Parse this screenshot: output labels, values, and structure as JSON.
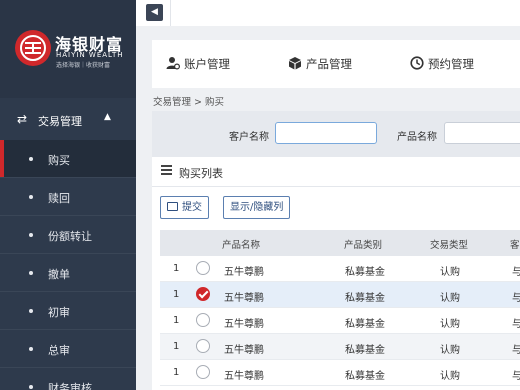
{
  "colors": {
    "sidebar_bg": "#2e3a4c",
    "brand_red": "#d0282b",
    "accent_blue": "#2f4f7f"
  },
  "logo": {
    "cn": "海银财富",
    "en": "HAIYIN WEALTH",
    "slogan": "选择海银｜收获财富"
  },
  "sidebar": {
    "group": {
      "icon": "swap-icon",
      "label": "交易管理",
      "expanded": true
    },
    "items": [
      {
        "label": "购买",
        "active": true
      },
      {
        "label": "赎回",
        "active": false
      },
      {
        "label": "份额转让",
        "active": false
      },
      {
        "label": "撤单",
        "active": false
      },
      {
        "label": "初审",
        "active": false
      },
      {
        "label": "总审",
        "active": false
      },
      {
        "label": "财务审核",
        "active": false
      }
    ]
  },
  "main_tabs": [
    {
      "icon": "user-gear-icon",
      "label": "账户管理"
    },
    {
      "icon": "cube-icon",
      "label": "产品管理"
    },
    {
      "icon": "clock-icon",
      "label": "预约管理"
    }
  ],
  "breadcrumb": "交易管理 > 购买",
  "search": {
    "customer_label": "客户名称",
    "customer_value": "",
    "product_label": "产品名称",
    "product_value": ""
  },
  "list": {
    "title": "购买列表",
    "submit_label": "提交",
    "toggle_columns_label": "显示/隐藏列",
    "columns": [
      "",
      "",
      "产品名称",
      "产品类别",
      "交易类型",
      "客"
    ],
    "rows": [
      {
        "no": "1",
        "selected": false,
        "product": "五牛尊鹏",
        "category": "私募基金",
        "type": "认购",
        "extra": "与"
      },
      {
        "no": "1",
        "selected": true,
        "product": "五牛尊鹏",
        "category": "私募基金",
        "type": "认购",
        "extra": "与"
      },
      {
        "no": "1",
        "selected": false,
        "product": "五牛尊鹏",
        "category": "私募基金",
        "type": "认购",
        "extra": "与"
      },
      {
        "no": "1",
        "selected": false,
        "product": "五牛尊鹏",
        "category": "私募基金",
        "type": "认购",
        "extra": "与"
      },
      {
        "no": "1",
        "selected": false,
        "product": "五牛尊鹏",
        "category": "私募基金",
        "type": "认购",
        "extra": "与"
      }
    ]
  }
}
